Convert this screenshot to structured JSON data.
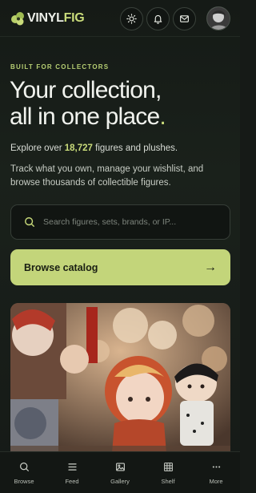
{
  "header": {
    "logo_vinyl": "VINYL",
    "logo_fig": "FIG",
    "buttons": [
      {
        "icon": "sun-icon"
      },
      {
        "icon": "bell-icon"
      },
      {
        "icon": "mail-icon"
      }
    ],
    "avatar": "user-avatar"
  },
  "hero": {
    "eyebrow": "BUILT FOR COLLECTORS",
    "title_line1": "Your collection,",
    "title_line2": "all in one place",
    "title_period": ".",
    "count_prefix": "Explore over",
    "count_value": "18,727",
    "count_suffix": "figures and plushes.",
    "description": "Track what you own, manage your wishlist, and browse thousands of collectible figures."
  },
  "search": {
    "placeholder": "Search figures, sets, brands, or IP...",
    "value": ""
  },
  "cta": {
    "label": "Browse catalog",
    "arrow": "→"
  },
  "nav": {
    "items": [
      {
        "label": "Browse",
        "icon": "search-icon"
      },
      {
        "label": "Feed",
        "icon": "menu-icon"
      },
      {
        "label": "Gallery",
        "icon": "image-icon"
      },
      {
        "label": "Shelf",
        "icon": "grid-icon"
      },
      {
        "label": "More",
        "icon": "more-icon"
      }
    ]
  },
  "colors": {
    "accent": "#c9db7a",
    "button": "#c3d57a",
    "background": "#161a17"
  }
}
